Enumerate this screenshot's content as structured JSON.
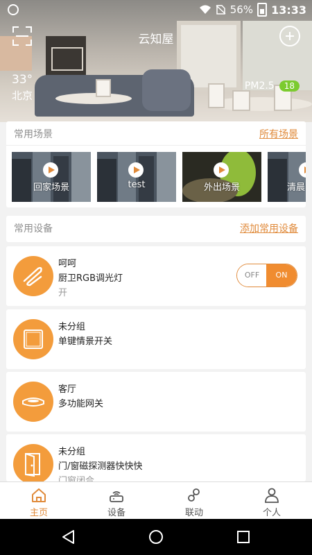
{
  "statusbar": {
    "battery": "56%",
    "time": "13:33"
  },
  "header": {
    "title": "云知屋"
  },
  "weather": {
    "temperature": "33°",
    "city": "北京",
    "pm_label": "PM2.5",
    "pm_value": "18"
  },
  "scenes_section": {
    "title": "常用场景",
    "link": "所有场景",
    "items": [
      {
        "label": "回家场景"
      },
      {
        "label": "test"
      },
      {
        "label": "外出场景"
      },
      {
        "label": "清晨"
      }
    ]
  },
  "devices_section": {
    "title": "常用设备",
    "link": "添加常用设备",
    "items": [
      {
        "room": "呵呵",
        "name": "厨卫RGB调光灯",
        "status": "开",
        "toggle_off": "OFF",
        "toggle_on": "ON",
        "icon": "dimmer-light-icon"
      },
      {
        "room": "未分组",
        "name": "单键情景开关",
        "status": "",
        "icon": "scene-switch-icon"
      },
      {
        "room": "客厅",
        "name": "多功能网关",
        "status": "",
        "icon": "gateway-icon"
      },
      {
        "room": "未分组",
        "name": "门/窗磁探测器快快快",
        "status": "门窗闭合",
        "icon": "door-sensor-icon"
      }
    ]
  },
  "tabbar": {
    "items": [
      {
        "label": "主页",
        "icon": "home-icon"
      },
      {
        "label": "设备",
        "icon": "router-icon"
      },
      {
        "label": "联动",
        "icon": "link-icon"
      },
      {
        "label": "个人",
        "icon": "person-icon"
      }
    ]
  },
  "colors": {
    "accent": "#E08A3A",
    "icon_bg": "#F39C3C",
    "pm_badge": "#7CCB2F"
  }
}
